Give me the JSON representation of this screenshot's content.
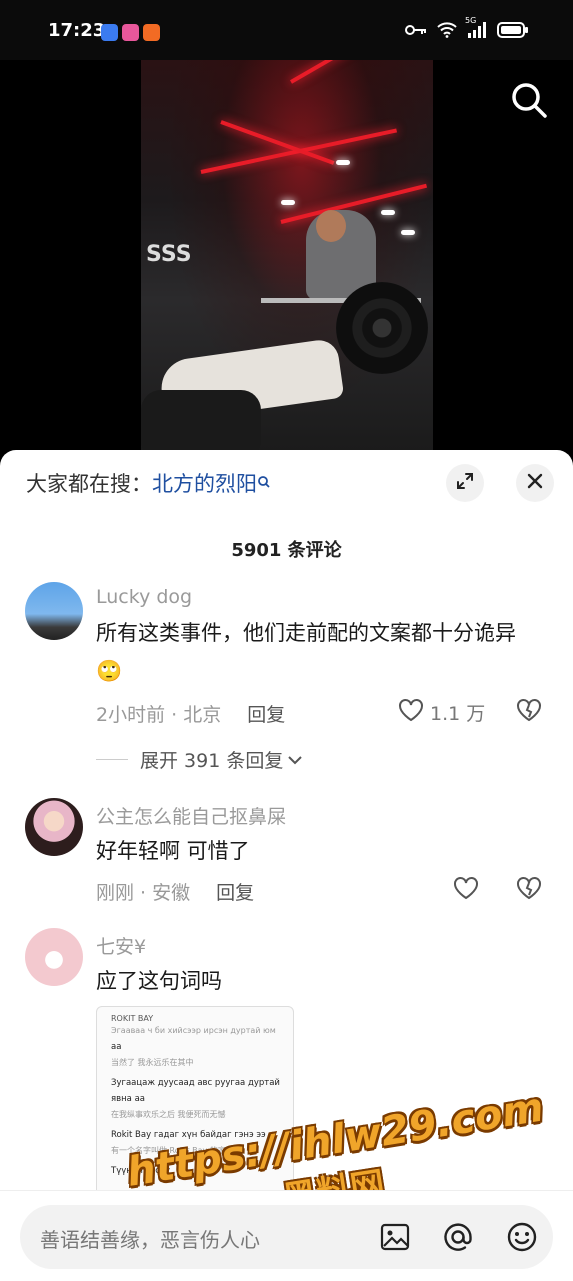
{
  "status_bar": {
    "time": "17:23",
    "network_label": "5G",
    "app_icon_colors": [
      "#3b7bf0",
      "#e8579b",
      "#f26b24"
    ],
    "icons": [
      "key-icon",
      "wifi-icon",
      "signal-icon",
      "battery-icon"
    ]
  },
  "video": {
    "search_icon": "search-icon",
    "gym_sign_text": "SSS"
  },
  "sheet": {
    "hot_search_prefix": "大家都在搜：",
    "hot_search_term": "北方的烈阳",
    "comment_count_label": "5901 条评论",
    "expand_icon": "expand-icon",
    "close_icon": "close-icon"
  },
  "comments": [
    {
      "username": "Lucky dog",
      "text": "所有这类事件，他们走前配的文案都十分诡异",
      "emoji": "🙄",
      "time_location": "2小时前 · 北京",
      "reply_label": "回复",
      "likes": "1.1 万",
      "expand_label": "展开 391 条回复"
    },
    {
      "username": "公主怎么能自己抠鼻屎",
      "text": "好年轻啊 可惜了",
      "time_location": "刚刚 · 安徽",
      "reply_label": "回复",
      "likes": ""
    },
    {
      "username": "七安¥",
      "text": "应了这句词吗",
      "attached_image_lines": [
        "ROKIT BAY",
        "Эгааваа ч би хийсээр ирсэн дуртай юм",
        "аа",
        "当然了 我永远乐在其中",
        "Зугаацаж дуусаад авс руугаа дуртай",
        "явна аа",
        "在我纵事欢乐之后 我便死而无憾",
        "Rokit Bay гадаг хүн байдаг гэнэ ээ",
        "有一个名字叫做 Rokit Bay 的家伙",
        "Түүнийг асуу"
      ]
    }
  ],
  "input_bar": {
    "placeholder": "善语结善缘，恶言伤人心",
    "icons": [
      "image-icon",
      "at-icon",
      "emoji-icon"
    ]
  },
  "watermark": {
    "url": "https://ihlw29.com",
    "name": "黑料网"
  }
}
